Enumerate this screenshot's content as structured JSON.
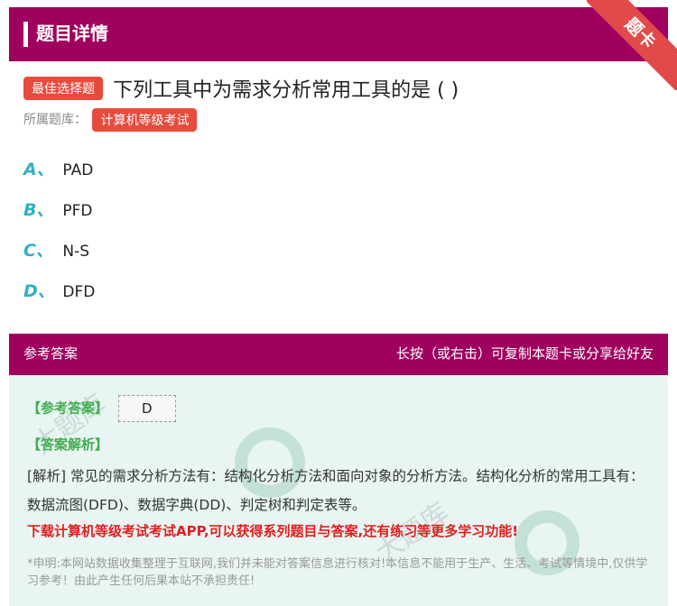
{
  "header": {
    "title": "题目详情",
    "corner_badge": "题卡"
  },
  "question": {
    "type_tag": "最佳选择题",
    "text": "下列工具中为需求分析常用工具的是 ( )",
    "bank_label": "所属题库：",
    "bank_name": "计算机等级考试"
  },
  "options": [
    {
      "letter": "A、",
      "text": "PAD"
    },
    {
      "letter": "B、",
      "text": "PFD"
    },
    {
      "letter": "C、",
      "text": "N-S"
    },
    {
      "letter": "D、",
      "text": "DFD"
    }
  ],
  "answer": {
    "section_label": "参考答案",
    "share_hint": "长按（或右击）可复制本题卡或分享给好友",
    "ref_label": "【参考答案】",
    "ref_value": "D",
    "analysis_label": "【答案解析】",
    "analysis_text": "[解析] 常见的需求分析方法有：结构化分析方法和面向对象的分析方法。结构化分析的常用工具有：数据流图(DFD)、数据字典(DD)、判定树和判定表等。",
    "promo": "下载计算机等级考试考试APP,可以获得系列题目与答案,还有练习等更多学习功能!",
    "disclaimer": "*申明:本网站数据收集整理于互联网,我们并未能对答案信息进行核对!本信息不能用于生产、生活、考试等情境中,仅供学习参考！由此产生任何后果本站不承担责任!"
  },
  "colors": {
    "brand": "#a0005e",
    "tag": "#e64b3c",
    "option_letter": "#2fb0c4",
    "answer_bg": "#e9f5f2"
  }
}
